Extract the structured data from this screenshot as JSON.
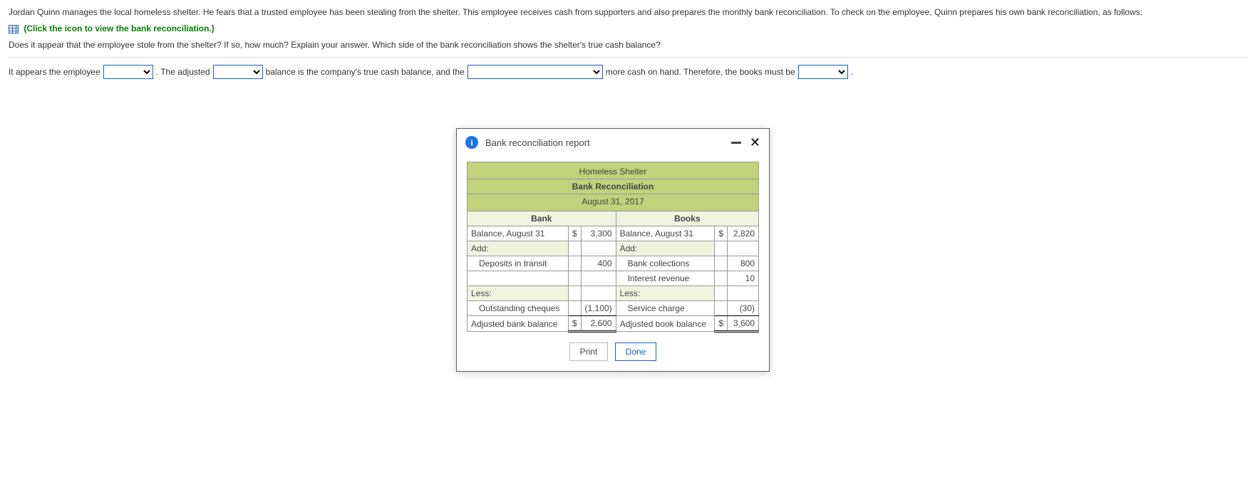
{
  "intro": {
    "p1": "Jordan Quinn manages the local homeless shelter. He fears that a trusted employee has been stealing from the shelter. This employee receives cash from supporters and also prepares the monthly bank reconciliation. To check on the employee, Quinn prepares his own bank reconciliation, as follows:",
    "link": "(Click the icon to view the bank reconciliation.)",
    "p2": "Does it appear that the employee stole from the shelter? If so, how much? Explain your answer. Which side of the bank reconciliation shows the shelter's true cash balance?"
  },
  "answer": {
    "t1": "It appears the employee",
    "t2": ". The adjusted",
    "t3": "balance is the company's true cash balance, and the",
    "t4": "more cash on hand. Therefore, the books must be",
    "t5": "."
  },
  "modal": {
    "title": "Bank reconciliation report",
    "org": "Homeless Shelter",
    "doc": "Bank Reconciliation",
    "date": "August 31, 2017",
    "bank_header": "Bank",
    "books_header": "Books",
    "bank": {
      "balance_label": "Balance, August 31",
      "balance_cur": "$",
      "balance_val": "3,300",
      "add_label": "Add:",
      "add_items": [
        {
          "label": "Deposits in transit",
          "val": "400"
        }
      ],
      "less_label": "Less:",
      "less_items": [
        {
          "label": "Outstanding cheques",
          "val": "(1,100)"
        }
      ],
      "adj_label": "Adjusted bank balance",
      "adj_cur": "$",
      "adj_val": "2,600"
    },
    "books": {
      "balance_label": "Balance, August 31",
      "balance_cur": "$",
      "balance_val": "2,820",
      "add_label": "Add:",
      "add_items": [
        {
          "label": "Bank collections",
          "val": "800"
        },
        {
          "label": "Interest revenue",
          "val": "10"
        }
      ],
      "less_label": "Less:",
      "less_items": [
        {
          "label": "Service charge",
          "val": "(30)"
        }
      ],
      "adj_label": "Adjusted book balance",
      "adj_cur": "$",
      "adj_val": "3,600"
    },
    "print": "Print",
    "done": "Done"
  }
}
